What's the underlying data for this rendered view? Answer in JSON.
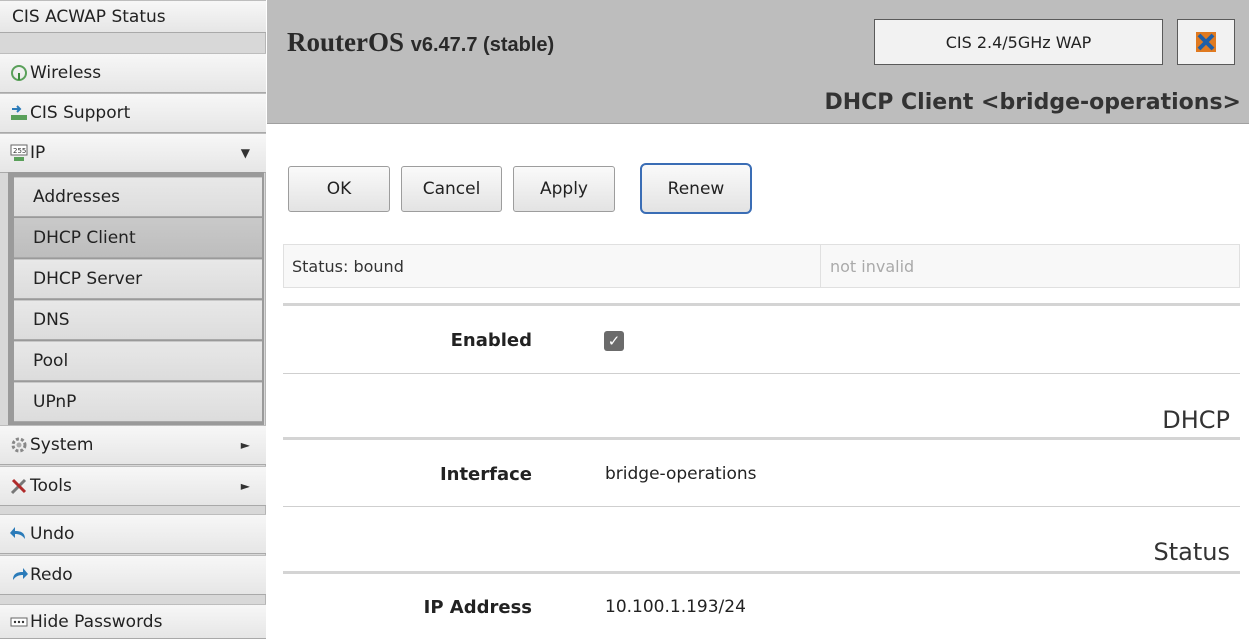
{
  "sidebar": {
    "acwap_status": "CIS ACWAP Status",
    "wireless": "Wireless",
    "cis_support": "CIS Support",
    "ip": "IP",
    "ip_arrow": "▼",
    "ip_sub": [
      "Addresses",
      "DHCP Client",
      "DHCP Server",
      "DNS",
      "Pool",
      "UPnP"
    ],
    "system": "System",
    "tools": "Tools",
    "submenu_arrow": "►",
    "undo": "Undo",
    "redo": "Redo",
    "hide_passwords": "Hide Passwords",
    "active_item": "DHCP Client"
  },
  "header": {
    "title": "RouterOS",
    "version": "v6.47.7 (stable)",
    "identity": "CIS 2.4/5GHz WAP",
    "page_heading": "DHCP Client <bridge-operations>"
  },
  "buttons": {
    "ok": "OK",
    "cancel": "Cancel",
    "apply": "Apply",
    "renew": "Renew"
  },
  "status_bar": {
    "status": "Status: bound",
    "validity": "not invalid"
  },
  "form": {
    "enabled_label": "Enabled",
    "enabled_checked": true,
    "enabled_glyph": "✓",
    "section_dhcp": "DHCP",
    "interface_label": "Interface",
    "interface_value": "bridge-operations",
    "section_status": "Status",
    "ip_label": "IP Address",
    "ip_value": "10.100.1.193/24"
  },
  "colors": {
    "renew_border": "#3a6db5",
    "header_bg": "#bdbdbd",
    "sidebar_bg": "#d8d8d8"
  }
}
